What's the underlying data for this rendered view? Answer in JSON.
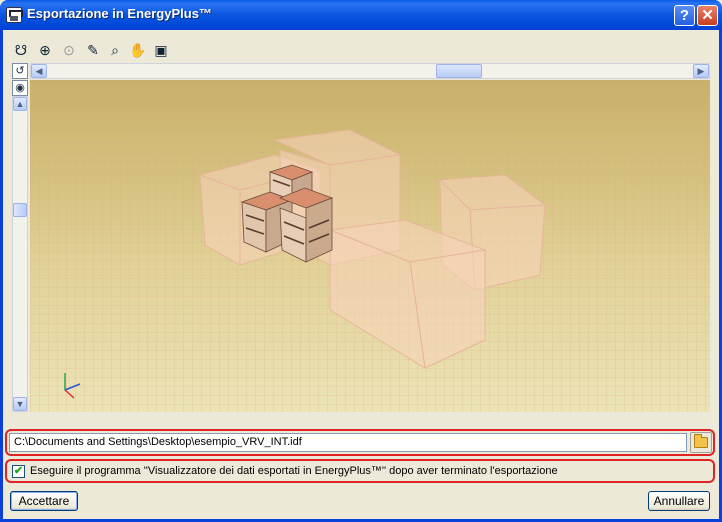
{
  "window": {
    "title": "Esportazione in EnergyPlus™",
    "help_label": "?",
    "close_label": "✕"
  },
  "toolbar": {
    "icons": [
      {
        "name": "orbit-icon",
        "glyph": "☋"
      },
      {
        "name": "zoom-extents-icon",
        "glyph": "⊕"
      },
      {
        "name": "zoom-previous-icon",
        "glyph": "⊙"
      },
      {
        "name": "pencil-icon",
        "glyph": "✎"
      },
      {
        "name": "zoom-window-icon",
        "glyph": "⌕"
      },
      {
        "name": "pan-hand-icon",
        "glyph": "✋"
      },
      {
        "name": "view-copy-icon",
        "glyph": "▣"
      }
    ],
    "side_buttons": [
      {
        "name": "rotate-icon",
        "glyph": "↺"
      },
      {
        "name": "eye-icon",
        "glyph": "◉"
      }
    ]
  },
  "scrollbars": {
    "left_arrow": "◀",
    "right_arrow": "▶",
    "up_arrow": "▲",
    "down_arrow": "▼"
  },
  "export": {
    "file_path": "C:\\Documents and Settings\\Desktop\\esempio_VRV_INT.idf",
    "run_viewer_checked": true,
    "run_viewer_label": "Eseguire il programma ''Visualizzatore dei dati esportati in EnergyPlus™'' dopo aver terminato l'esportazione"
  },
  "buttons": {
    "accept_label": "Accettare",
    "cancel_label": "Annullare"
  },
  "colors": {
    "title_bar": "#0a5ae8",
    "highlight_outline": "#e02424",
    "viewport_sky": "#c9b06a",
    "building_glass": "#f8d3bc"
  }
}
